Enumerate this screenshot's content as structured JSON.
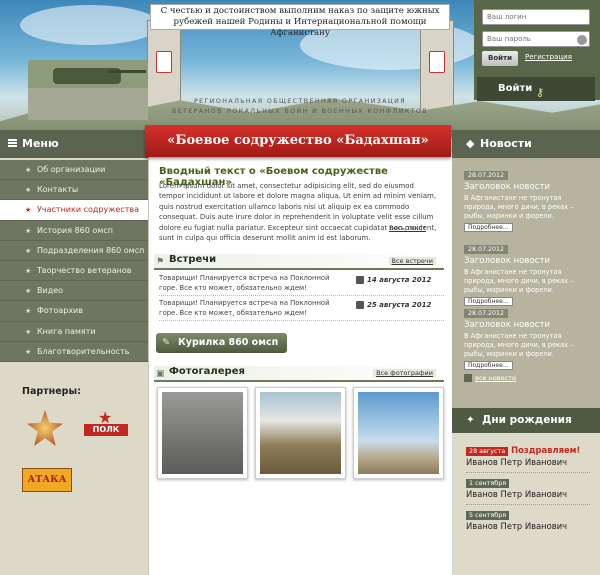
{
  "motto": {
    "line1": "С честью и достоинством выполним наказ по защите южных",
    "line2": "рубежей нашей Родины и Интернациональной помощи Афганистану"
  },
  "org": {
    "line1": "РЕГИОНАЛЬНАЯ ОБЩЕСТВЕННАЯ ОРГАНИЗАЦИЯ",
    "line2": "ВЕТЕРАНОВ ЛОКАЛЬНЫХ ВОЙН И ВОЕННЫХ КОНФЛИКТОВ"
  },
  "login": {
    "login_placeholder": "Ваш логин",
    "password_placeholder": "Ваш пароль",
    "submit_label": "Войти",
    "register_label": "Регистрация",
    "enter_label": "Войти"
  },
  "title": "«Боевое содружество «Бадахшан»",
  "menu": {
    "heading": "Меню",
    "items": [
      {
        "label": "Об организации"
      },
      {
        "label": "Контакты"
      },
      {
        "label": "Участники содружества"
      },
      {
        "label": "История 860 омсп"
      },
      {
        "label": "Подразделения 860 омсп"
      },
      {
        "label": "Творчество ветеранов"
      },
      {
        "label": "Видео"
      },
      {
        "label": "Фотоархив"
      },
      {
        "label": "Книга памяти"
      },
      {
        "label": "Благотворительность"
      }
    ]
  },
  "partners": {
    "heading": "Партнеры:",
    "logo2_text": "ПОЛК",
    "logo3_text": "АТАКА"
  },
  "intro": {
    "title": "Вводный текст о «Боевом содружестве «Бадахшан»",
    "text": "Lorem ipsum dolor sit amet, consectetur adipisicing elit, sed do eiusmod tempor incididunt ut labore et dolore magna aliqua. Ut enim ad minim veniam, quis nostrud exercitation ullamco laboris nisi ut aliquip ex ea commodo consequat. Duis aute irure dolor in reprehenderit in voluptate velit esse cillum dolore eu fugiat nulla pariatur. Excepteur sint occaecat cupidatat non proident, sunt in culpa qui officia deserunt mollit anim id est laborum.",
    "more": "Весь текст"
  },
  "meetings": {
    "heading": "Встречи",
    "all_link": "Все встречи",
    "items": [
      {
        "text": "Товарищи! Планируется встреча на Поклонной горе. Все кто может, обязательно ждем!",
        "date": "14 августа 2012"
      },
      {
        "text": "Товарищи! Планируется встреча на Поклонной горе. Все кто может, обязательно ждем!",
        "date": "25 августа 2012"
      }
    ]
  },
  "kurilka": {
    "label": "Курилка 860 омсп"
  },
  "gallery": {
    "heading": "Фотогалерея",
    "all_link": "Все фотографии"
  },
  "news": {
    "heading": "Новости",
    "items": [
      {
        "date": "28.07.2012",
        "title": "Заголовок новости",
        "text": "В Афганистане не тронутая природа, много дичи, в реках – рыбы, маринки и форели.",
        "button": "Подробнее..."
      },
      {
        "date": "28.07.2012",
        "title": "Заголовок новости",
        "text": "В Афганистане не тронутая природа, много дичи, в реках – рыбы, маринки и форели.",
        "button": "Подробнее..."
      },
      {
        "date": "28.07.2012",
        "title": "Заголовок новости",
        "text": "В Афганистане не тронутая природа, много дичи, в реках – рыбы, маринки и форели.",
        "button": "Подробнее..."
      }
    ],
    "all_link": "все новости"
  },
  "birthdays": {
    "heading": "Дни рождения",
    "items": [
      {
        "date": "28 августа",
        "congrats": "Поздравляем!",
        "name": "Иванов Петр Иванович"
      },
      {
        "date": "1 сентября",
        "congrats": "",
        "name": "Иванов Петр Иванович"
      },
      {
        "date": "5 сентября",
        "congrats": "",
        "name": "Иванов Петр Иванович"
      }
    ]
  },
  "colors": {
    "accent_red": "#c4231c",
    "panel_green": "#5a6450",
    "title_green": "#496218"
  }
}
